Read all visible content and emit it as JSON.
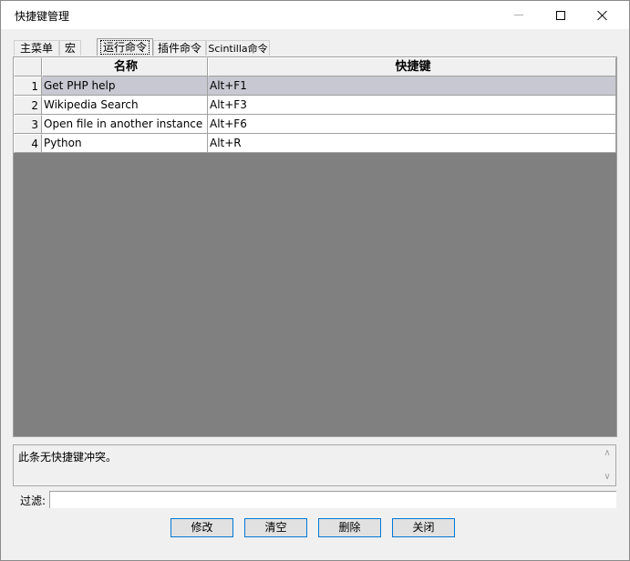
{
  "window": {
    "title": "快捷键管理"
  },
  "tabs": [
    {
      "label": "主菜单",
      "active": false
    },
    {
      "label": "宏",
      "active": false
    },
    {
      "label": "运行命令",
      "active": true
    },
    {
      "label": "插件命令",
      "active": false
    },
    {
      "label": "Scintilla命令",
      "active": false
    }
  ],
  "grid": {
    "columns": [
      "名称",
      "快捷键"
    ],
    "rows": [
      {
        "num": "1",
        "name": "Get PHP help",
        "shortcut": "Alt+F1",
        "selected": true
      },
      {
        "num": "2",
        "name": "Wikipedia Search",
        "shortcut": "Alt+F3",
        "selected": false
      },
      {
        "num": "3",
        "name": "Open file in another instance",
        "shortcut": "Alt+F6",
        "selected": false
      },
      {
        "num": "4",
        "name": "Python",
        "shortcut": "Alt+R",
        "selected": false
      }
    ]
  },
  "conflict": {
    "text": "此条无快捷键冲突。"
  },
  "filter": {
    "label": "过滤:",
    "value": ""
  },
  "buttons": {
    "modify": "修改",
    "clear": "清空",
    "delete": "删除",
    "close": "关闭"
  },
  "colors": {
    "selected_row": "#c8c8d2",
    "grid_background": "#808080",
    "button_focus_border": "#0078d7"
  }
}
